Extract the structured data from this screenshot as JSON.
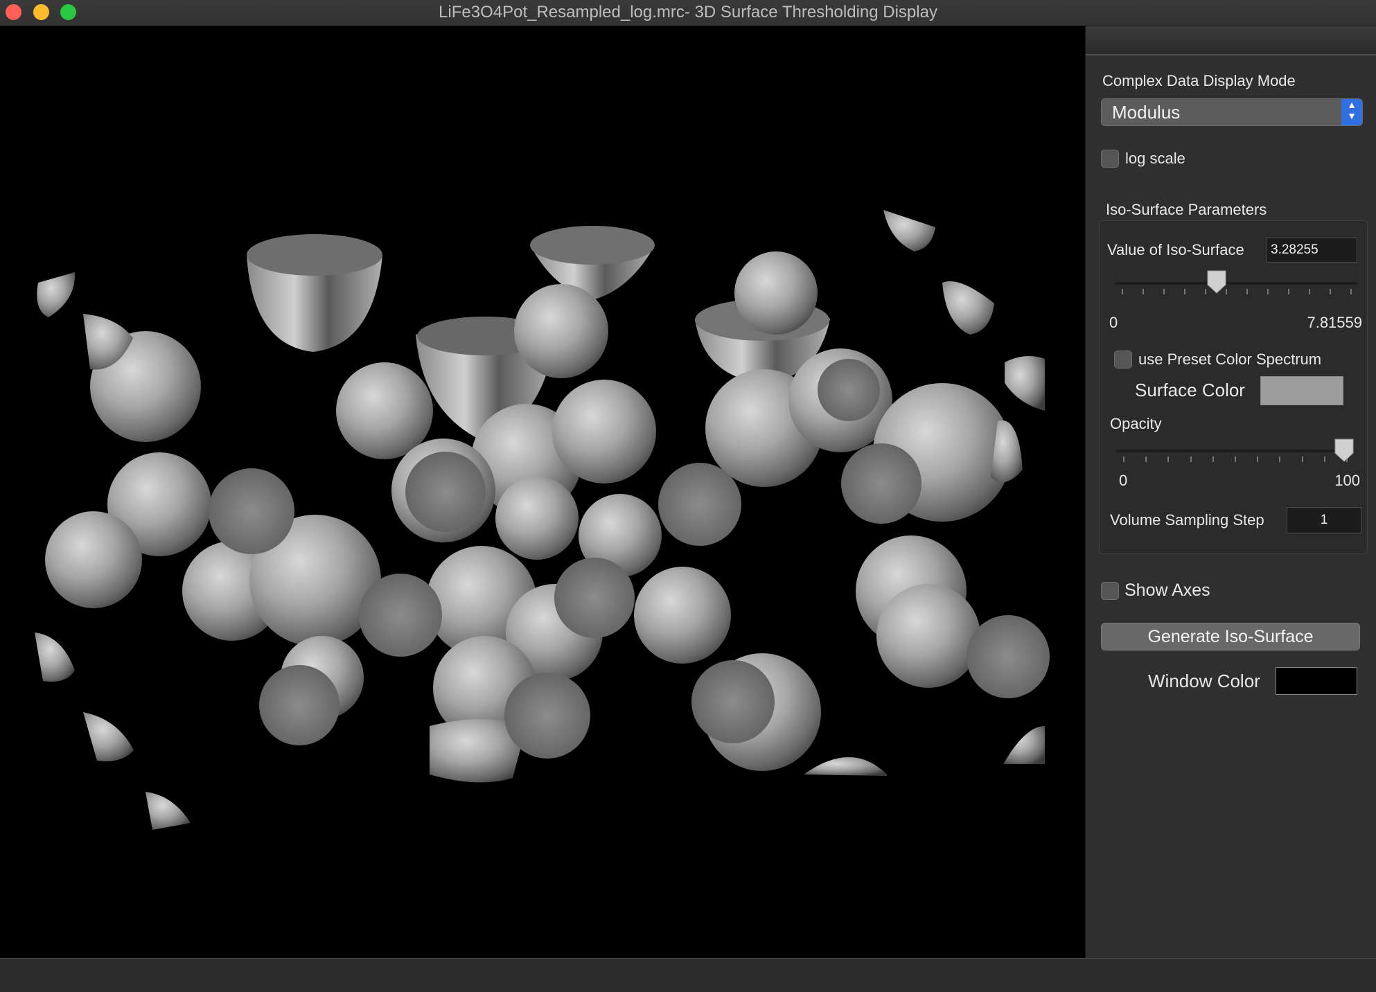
{
  "window": {
    "title": "LiFe3O4Pot_Resampled_log.mrc- 3D Surface Thresholding Display"
  },
  "panel": {
    "complex_mode_label": "Complex Data Display Mode",
    "complex_mode_value": "Modulus",
    "log_scale_label": "log scale",
    "iso_group_label": "Iso-Surface Parameters",
    "iso_value_label": "Value of Iso-Surface",
    "iso_value": "3.28255",
    "iso_min": "0",
    "iso_max": "7.81559",
    "iso_slider_fraction": 0.42,
    "preset_color_label": "use Preset Color Spectrum",
    "surface_color_label": "Surface Color",
    "surface_color": "#9e9e9e",
    "opacity_label": "Opacity",
    "opacity_min": "0",
    "opacity_max": "100",
    "opacity_value": 100,
    "sampling_label": "Volume Sampling Step",
    "sampling_value": "1",
    "show_axes_label": "Show  Axes",
    "generate_button": "Generate Iso-Surface",
    "window_color_label": "Window Color",
    "window_color": "#000000"
  },
  "colors": {
    "close": "#ff5f57",
    "minimize": "#febc2e",
    "maximize": "#28c840",
    "select_accent": "#2f6fe0"
  }
}
